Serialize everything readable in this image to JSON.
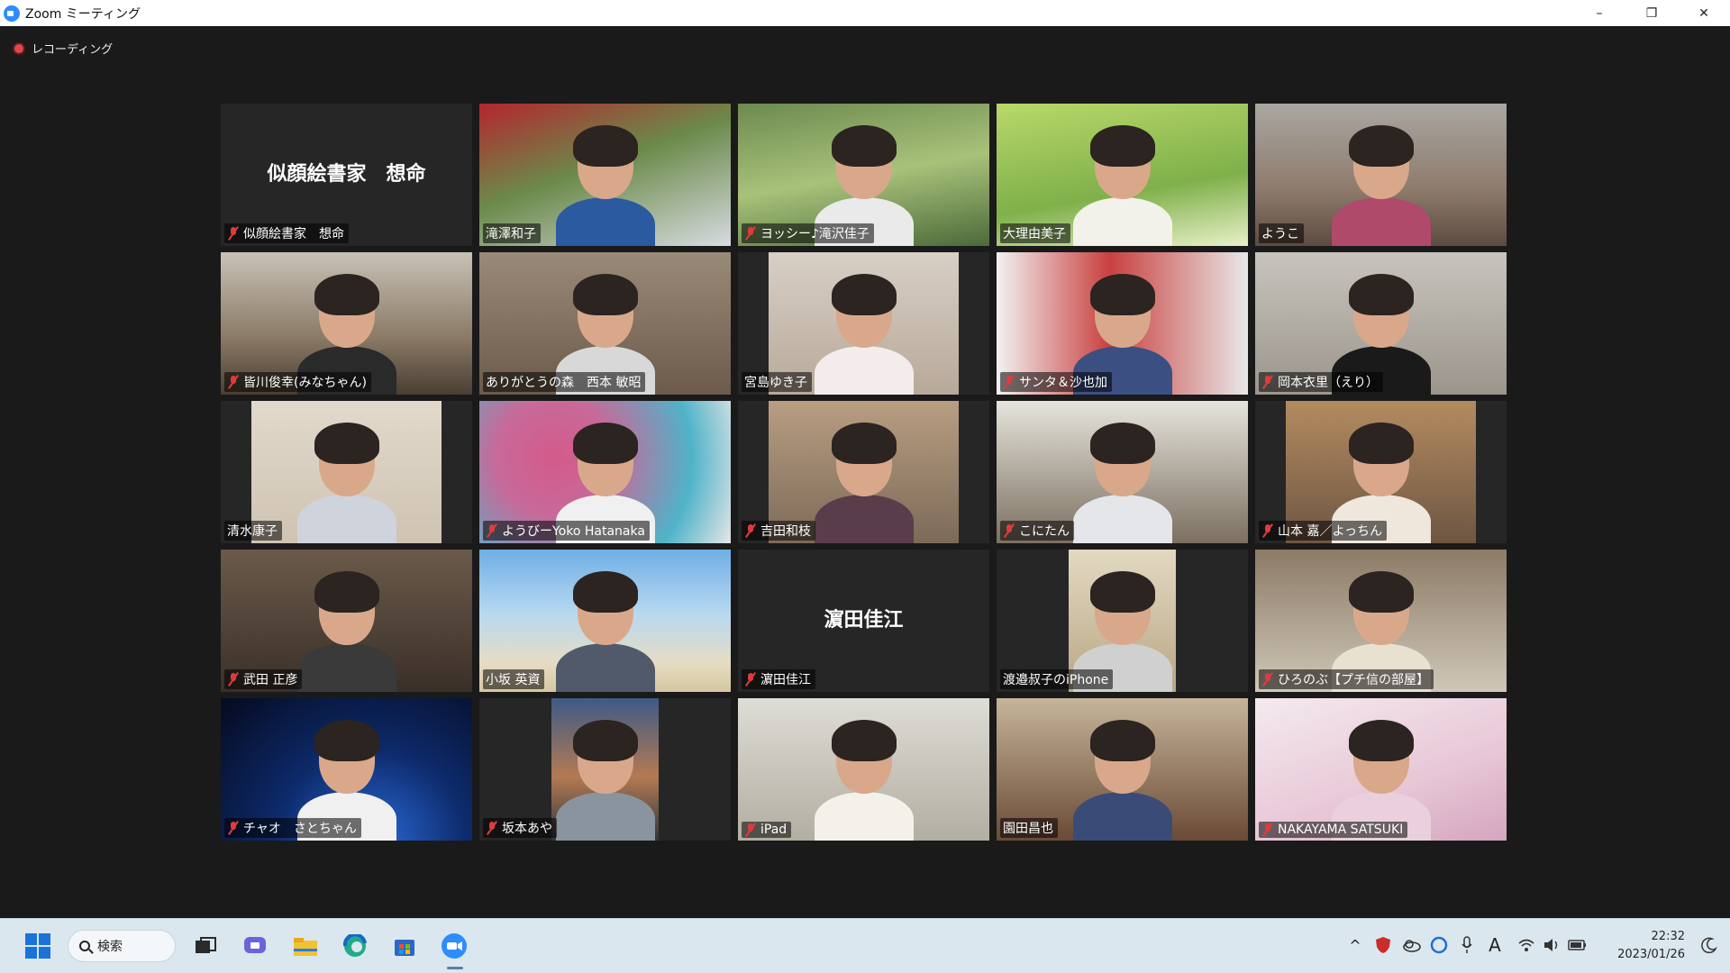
{
  "window": {
    "title": "Zoom ミーティング",
    "controls": {
      "minimize": "–",
      "restore": "❐",
      "close": "✕"
    }
  },
  "recording": {
    "label": "レコーディング",
    "color": "#e04848"
  },
  "participants": [
    {
      "name": "似顔絵書家　想命",
      "video": false,
      "center_name": "似顔絵書家　想命",
      "muted": true
    },
    {
      "name": "滝澤和子",
      "video": true,
      "muted": false,
      "active_speaker": true
    },
    {
      "name": "ヨッシー♪滝沢佳子",
      "video": true,
      "muted": true
    },
    {
      "name": "大理由美子",
      "video": true,
      "muted": false
    },
    {
      "name": "ようこ",
      "video": true,
      "muted": false
    },
    {
      "name": "皆川俊幸(みなちゃん)",
      "video": true,
      "muted": true
    },
    {
      "name": "ありがとうの森　西本 敏昭",
      "video": true,
      "muted": false
    },
    {
      "name": "宮島ゆき子",
      "video": true,
      "muted": false
    },
    {
      "name": "サンタ＆沙也加",
      "video": true,
      "muted": true
    },
    {
      "name": "岡本衣里（えり）",
      "video": true,
      "muted": true
    },
    {
      "name": "清水康子",
      "video": true,
      "muted": false
    },
    {
      "name": "ようびーYoko Hatanaka",
      "video": true,
      "muted": true
    },
    {
      "name": "吉田和枝",
      "video": true,
      "muted": true
    },
    {
      "name": "こにたん",
      "video": true,
      "muted": true
    },
    {
      "name": "山本 嘉／よっちん",
      "video": true,
      "muted": true
    },
    {
      "name": "武田 正彦",
      "video": true,
      "muted": true
    },
    {
      "name": "小坂 英資",
      "video": true,
      "muted": false
    },
    {
      "name": "濵田佳江",
      "video": false,
      "center_name": "濵田佳江",
      "muted": true
    },
    {
      "name": "渡邉叔子のiPhone",
      "video": true,
      "muted": false
    },
    {
      "name": "ひろのぶ【プチ信の部屋】",
      "video": true,
      "muted": true
    },
    {
      "name": "チャオ　さとちゃん",
      "video": true,
      "muted": true
    },
    {
      "name": "坂本あや",
      "video": true,
      "muted": true
    },
    {
      "name": "iPad",
      "video": true,
      "muted": true
    },
    {
      "name": "園田昌也",
      "video": true,
      "muted": false
    },
    {
      "name": "NAKAYAMA SATSUKI",
      "video": true,
      "muted": true
    }
  ],
  "taskbar": {
    "search_label": "検索",
    "time": "22:32",
    "date": "2023/01/26",
    "apps": [
      "windows-start-icon",
      "task-view-icon",
      "chat-icon",
      "file-explorer-icon",
      "edge-icon",
      "store-icon",
      "zoom-icon"
    ],
    "tray_icons": [
      "chevron-up-icon",
      "shield-icon",
      "cloud-icon",
      "sync-icon",
      "microphone-icon",
      "ime-icon",
      "wifi-icon",
      "speaker-icon",
      "battery-icon",
      "moon-icon"
    ]
  },
  "colors": {
    "background": "#1a1a1a",
    "tile": "#262626",
    "active_border": "#e8e23a",
    "taskbar": "#dbe7ef",
    "zoom_blue": "#2d8cff"
  }
}
